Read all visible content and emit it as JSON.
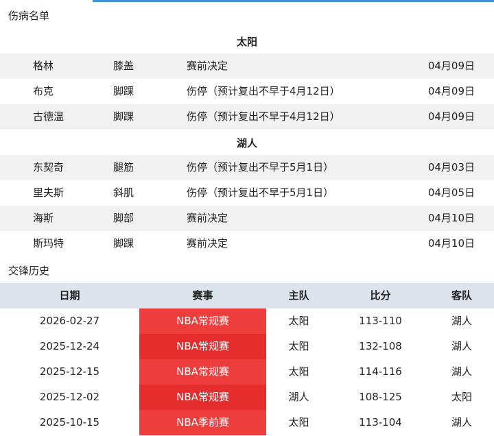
{
  "injury": {
    "title": "伤病名单",
    "teams": [
      {
        "name": "太阳",
        "players": [
          {
            "name": "格林",
            "part": "膝盖",
            "status": "赛前决定",
            "date": "04月09日"
          },
          {
            "name": "布克",
            "part": "脚踝",
            "status": "伤停（预计复出不早于4月12日）",
            "date": "04月09日"
          },
          {
            "name": "古德温",
            "part": "脚踝",
            "status": "伤停（预计复出不早于4月12日）",
            "date": "04月09日"
          }
        ]
      },
      {
        "name": "湖人",
        "players": [
          {
            "name": "东契奇",
            "part": "腿筋",
            "status": "伤停（预计复出不早于5月1日）",
            "date": "04月03日"
          },
          {
            "name": "里夫斯",
            "part": "斜肌",
            "status": "伤停（预计复出不早于5月1日）",
            "date": "04月05日"
          },
          {
            "name": "海斯",
            "part": "脚部",
            "status": "赛前决定",
            "date": "04月10日"
          },
          {
            "name": "斯玛特",
            "part": "脚踝",
            "status": "赛前决定",
            "date": "04月10日"
          }
        ]
      }
    ]
  },
  "history": {
    "title": "交锋历史",
    "columns": [
      "日期",
      "赛事",
      "主队",
      "比分",
      "客队"
    ],
    "rows": [
      {
        "date": "2026-02-27",
        "event": "NBA常规赛",
        "home": "太阳",
        "score": "113-110",
        "away": "湖人"
      },
      {
        "date": "2025-12-24",
        "event": "NBA常规赛",
        "home": "太阳",
        "score": "132-108",
        "away": "湖人"
      },
      {
        "date": "2025-12-15",
        "event": "NBA常规赛",
        "home": "太阳",
        "score": "114-116",
        "away": "湖人"
      },
      {
        "date": "2025-12-02",
        "event": "NBA常规赛",
        "home": "湖人",
        "score": "108-125",
        "away": "太阳"
      },
      {
        "date": "2025-10-15",
        "event": "NBA季前赛",
        "home": "太阳",
        "score": "113-104",
        "away": "湖人"
      }
    ]
  },
  "colors": {
    "accent_line": "#3f8fd8",
    "event_cell": "#ee3d3d",
    "event_cell_alt": "#e52d2d",
    "header_bg": "#dde3ec",
    "row_shade": "#f1f1f1"
  }
}
